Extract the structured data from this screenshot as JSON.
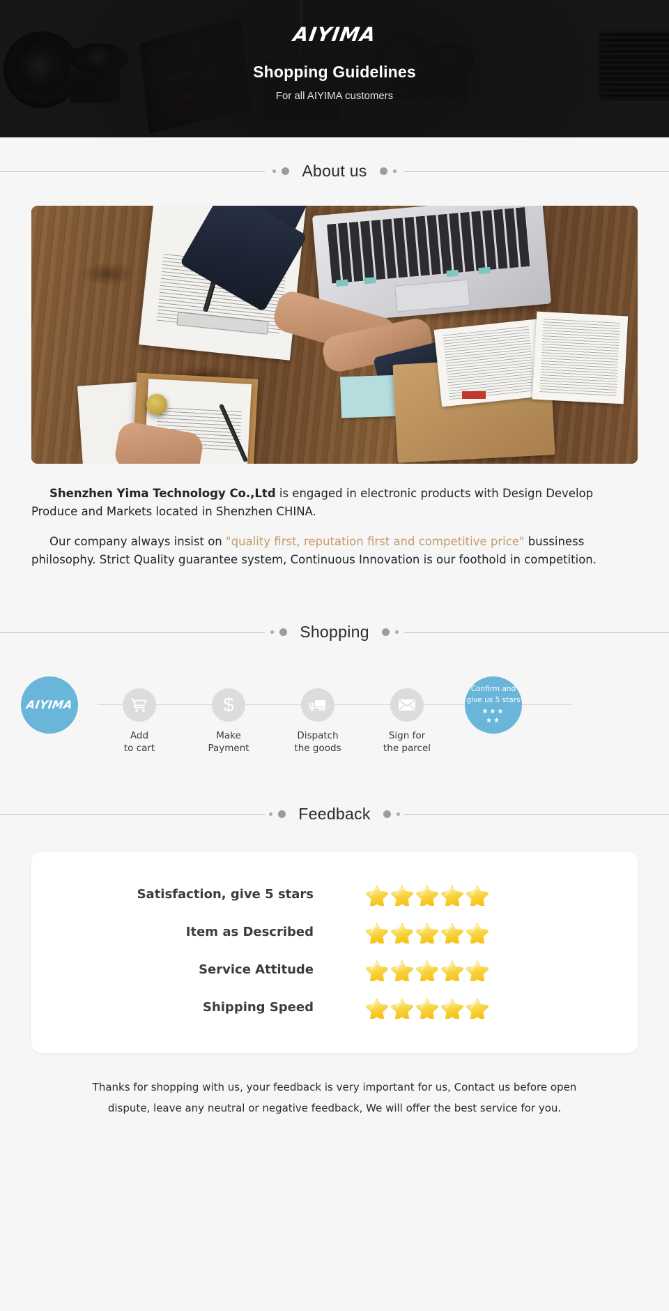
{
  "hero": {
    "logo": "AIYIMA",
    "title": "Shopping Guidelines",
    "subtitle": "For all AIYIMA customers"
  },
  "sections": {
    "about": {
      "heading": "About us"
    },
    "shopping": {
      "heading": "Shopping"
    },
    "feedback": {
      "heading": "Feedback"
    }
  },
  "about": {
    "image_alt": "handshake-over-desk-photo",
    "paragraph1_company": "Shenzhen Yima Technology Co.,Ltd",
    "paragraph1_rest": " is engaged in electronic products with Design Develop Produce and Markets located in Shenzhen CHINA.",
    "paragraph2_lead": "Our company always insist on ",
    "paragraph2_quote": "\"quality first, reputation first and competitive price\"",
    "paragraph2_rest": " bussiness philosophy. Strict Quality guarantee system, Continuous Innovation is our foothold in competition."
  },
  "shopping": {
    "steps": [
      {
        "id": "brand",
        "icon": "aiyima-logo-icon",
        "label_line1": "",
        "label_line2": "",
        "badge": "AIYIMA"
      },
      {
        "id": "cart",
        "icon": "shopping-cart-icon",
        "label_line1": "Add",
        "label_line2": "to cart"
      },
      {
        "id": "payment",
        "icon": "dollar-icon",
        "label_line1": "Make",
        "label_line2": "Payment"
      },
      {
        "id": "dispatch",
        "icon": "truck-icon",
        "label_line1": "Dispatch",
        "label_line2": "the goods"
      },
      {
        "id": "sign",
        "icon": "envelope-icon",
        "label_line1": "Sign for",
        "label_line2": "the parcel"
      },
      {
        "id": "confirm",
        "icon": "star-rating-icon",
        "final_line1": "Confirm and",
        "final_line2": "give us 5 stars",
        "stars_top": "★★★",
        "stars_bottom": "★★"
      }
    ]
  },
  "feedback": {
    "rows": [
      {
        "label": "Satisfaction, give 5 stars",
        "stars": 5
      },
      {
        "label": "Item as Described",
        "stars": 5
      },
      {
        "label": "Service Attitude",
        "stars": 5
      },
      {
        "label": "Shipping Speed",
        "stars": 5
      }
    ]
  },
  "footer": {
    "line1": "Thanks for shopping with us, your feedback is very important for us, Contact us before open",
    "line2": "dispute, leave any neutral or negative feedback, We will offer the best service for you."
  },
  "colors": {
    "page_bg": "#f6f6f6",
    "hero_bg": "#171717",
    "accent_blue": "#6ab5da",
    "step_circle_gray": "#dcdcdc",
    "quote_text": "#c79a6b",
    "star_gold": "#f7d13a",
    "card_white": "#ffffff"
  }
}
